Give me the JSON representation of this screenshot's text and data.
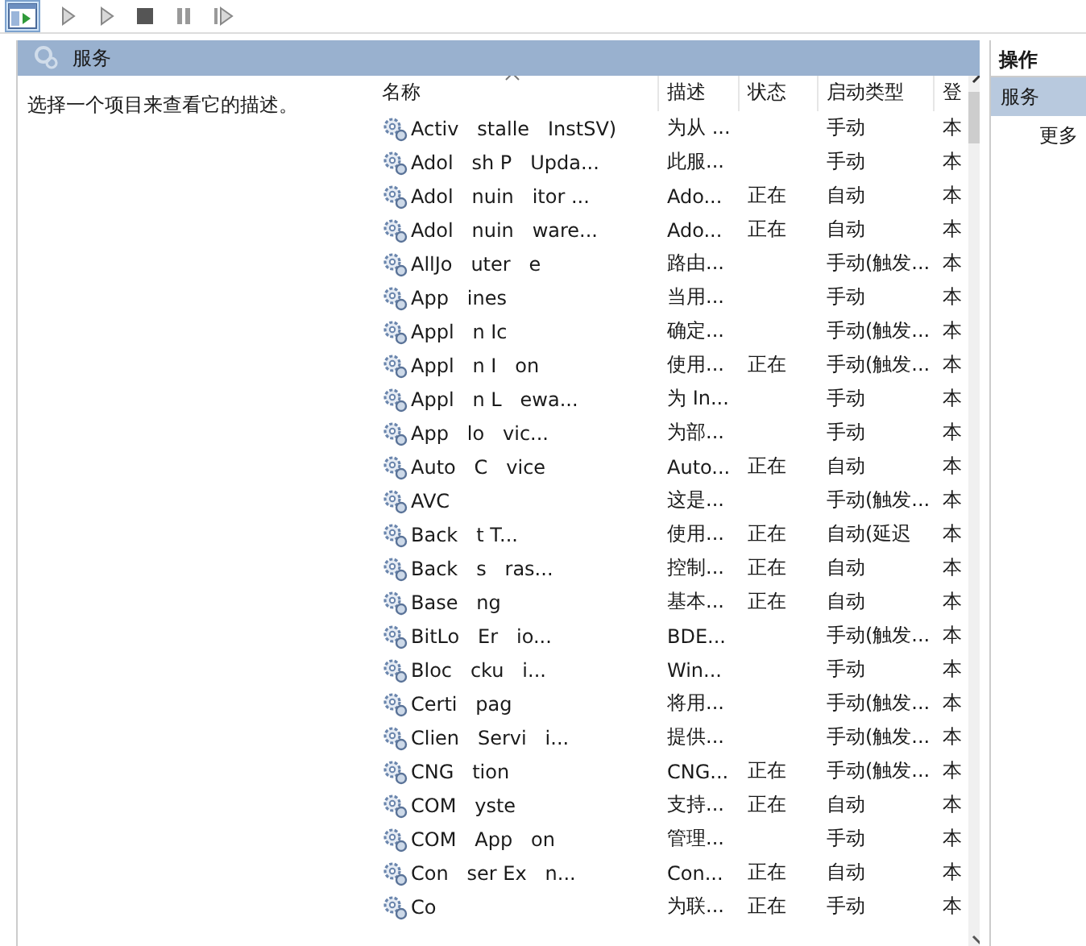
{
  "header": {
    "title": "服务"
  },
  "description_pane": {
    "text": "选择一个项目来查看它的描述。"
  },
  "table": {
    "columns": [
      {
        "label": "名称",
        "sorted": true
      },
      {
        "label": "描述",
        "sorted": false
      },
      {
        "label": "状态",
        "sorted": false
      },
      {
        "label": "启动类型",
        "sorted": false
      },
      {
        "label": "登",
        "sorted": false
      }
    ],
    "rows": [
      {
        "name": "Activ   stalle   InstSV)",
        "description": "为从 ...",
        "status": "",
        "startup": "手动",
        "logon": "本"
      },
      {
        "name": "Adol   sh P   Upda...",
        "description": "此服...",
        "status": "",
        "startup": "手动",
        "logon": "本"
      },
      {
        "name": "Adol   nuin   itor ...",
        "description": "Ado...",
        "status": "正在",
        "startup": "自动",
        "logon": "本"
      },
      {
        "name": "Adol   nuin   ware...",
        "description": "Ado...",
        "status": "正在",
        "startup": "自动",
        "logon": "本"
      },
      {
        "name": "AllJo   uter   e",
        "description": "路由...",
        "status": "",
        "startup": "手动(触发...",
        "logon": "本"
      },
      {
        "name": "App   ines",
        "description": "当用...",
        "status": "",
        "startup": "手动",
        "logon": "本"
      },
      {
        "name": "Appl   n Ic",
        "description": "确定...",
        "status": "",
        "startup": "手动(触发...",
        "logon": "本"
      },
      {
        "name": "Appl   n I   on",
        "description": "使用...",
        "status": "正在",
        "startup": "手动(触发...",
        "logon": "本"
      },
      {
        "name": "Appl   n L   ewa...",
        "description": "为 In...",
        "status": "",
        "startup": "手动",
        "logon": "本"
      },
      {
        "name": "App   lo   vic...",
        "description": "为部...",
        "status": "",
        "startup": "手动",
        "logon": "本"
      },
      {
        "name": "Auto   C   vice",
        "description": "Auto...",
        "status": "正在",
        "startup": "自动",
        "logon": "本"
      },
      {
        "name": "AVC",
        "description": "这是...",
        "status": "",
        "startup": "手动(触发...",
        "logon": "本"
      },
      {
        "name": "Back   t T...",
        "description": "使用...",
        "status": "正在",
        "startup": "自动(延迟",
        "logon": "本"
      },
      {
        "name": "Back   s   ras...",
        "description": "控制...",
        "status": "正在",
        "startup": "自动",
        "logon": "本"
      },
      {
        "name": "Base   ng",
        "description": "基本...",
        "status": "正在",
        "startup": "自动",
        "logon": "本"
      },
      {
        "name": "BitLo   Er   io...",
        "description": "BDE...",
        "status": "",
        "startup": "手动(触发...",
        "logon": "本"
      },
      {
        "name": "Bloc   cku   i...",
        "description": "Win...",
        "status": "",
        "startup": "手动",
        "logon": "本"
      },
      {
        "name": "Certi   pag",
        "description": "将用...",
        "status": "",
        "startup": "手动(触发...",
        "logon": "本"
      },
      {
        "name": "Clien   Servi   i...",
        "description": "提供...",
        "status": "",
        "startup": "手动(触发...",
        "logon": "本"
      },
      {
        "name": "CNG   tion",
        "description": "CNG...",
        "status": "正在",
        "startup": "手动(触发...",
        "logon": "本"
      },
      {
        "name": "COM   yste",
        "description": "支持...",
        "status": "正在",
        "startup": "自动",
        "logon": "本"
      },
      {
        "name": "COM   App   on",
        "description": "管理...",
        "status": "",
        "startup": "手动",
        "logon": "本"
      },
      {
        "name": "Con   ser Ex   n...",
        "description": "Con...",
        "status": "正在",
        "startup": "自动",
        "logon": "本"
      },
      {
        "name": "Co",
        "description": "为联...",
        "status": "正在",
        "startup": "手动",
        "logon": "本"
      }
    ]
  },
  "actions": {
    "title": "操作",
    "items": [
      {
        "label": "服务",
        "selected": true
      },
      {
        "label": "更多",
        "selected": false
      }
    ]
  }
}
